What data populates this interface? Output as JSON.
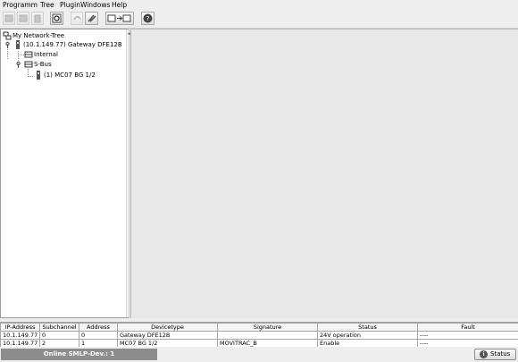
{
  "menu": [
    "Programm",
    "Tree",
    "PluginWindows",
    "Help"
  ],
  "toolbar": {
    "buttons": [
      "new-icon",
      "delete-icon",
      "trash-icon",
      "refresh-icon",
      "undo-icon",
      "tools-icon",
      "export-icon",
      "help-icon"
    ]
  },
  "tree": {
    "root": "My Network-Tree",
    "gateway": "(10.1.149.77) Gateway DFE12B",
    "internal": "Internal",
    "sbus": "S-Bus",
    "device": "(1) MC07 BG 1/2"
  },
  "table": {
    "headers": [
      "IP-Address",
      "Subchannel",
      "Address",
      "Devicetype",
      "Signature",
      "Status",
      "Fault"
    ],
    "rows": [
      [
        "10.1.149.77",
        "0",
        "0",
        "Gateway DFE12B",
        "",
        "24V operation",
        "----"
      ],
      [
        "10.1.149.77",
        "2",
        "1",
        "MC07 BG 1/2",
        "MOVITRAC_B",
        "Enable",
        "----"
      ]
    ]
  },
  "statusbar": {
    "online_text": "Online SMLP-Dev.: 1",
    "status_button": "Status"
  },
  "colors": {
    "online_bg": "#8d8d8d",
    "content_bg": "#e8e8e8"
  }
}
